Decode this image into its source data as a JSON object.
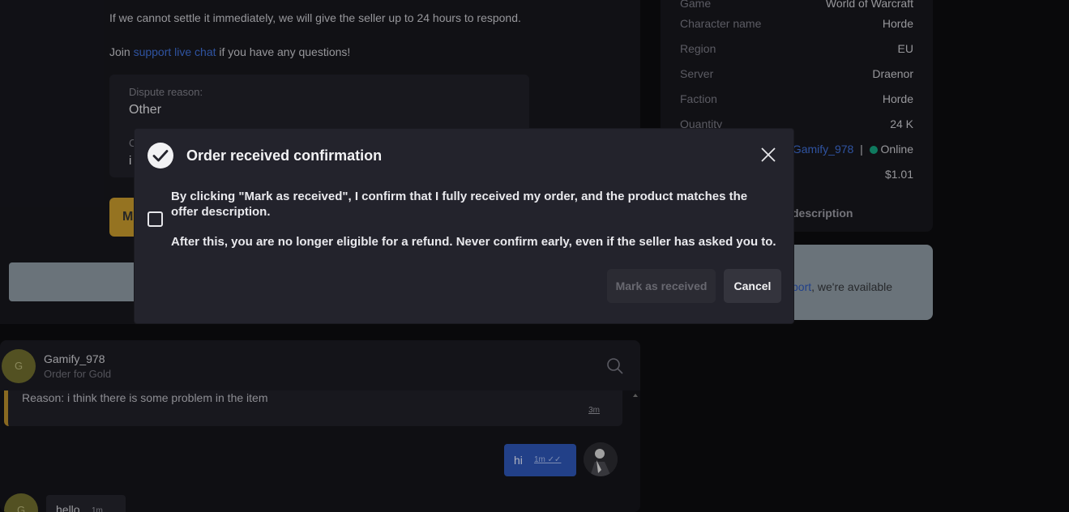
{
  "background": {
    "line_settle": "If we cannot settle it immediately, we will give the seller up to 24 hours to respond.",
    "join_prefix": "Join ",
    "join_link": "support live chat",
    "join_suffix": " if you have any questions!",
    "dispute_reason_label": "Dispute reason:",
    "dispute_reason_value": "Other",
    "comment_label_partial": "C",
    "comment_value_partial": "i",
    "yellow_button_partial": "M"
  },
  "order_details": {
    "rows": [
      {
        "label": "Game",
        "value": "World of Warcraft"
      },
      {
        "label": "Character name",
        "value": "Horde"
      },
      {
        "label": "Region",
        "value": "EU"
      },
      {
        "label": "Server",
        "value": "Draenor"
      },
      {
        "label": "Faction",
        "value": "Horde"
      },
      {
        "label": "Quantity",
        "value": "24 K"
      }
    ],
    "seller_name": "Gamify_978",
    "seller_separator": "|",
    "seller_status": "Online",
    "price": "$1.01",
    "description_partial": "description"
  },
  "support_card": {
    "text_link_partial": "port",
    "text_suffix": ", we're available"
  },
  "chat": {
    "avatar_initial": "G",
    "name": "Gamify_978",
    "subtitle": "Order for Gold",
    "system_message": "Reason: i think there is some problem in the item",
    "system_time": "3m",
    "outgoing_message": "hi",
    "outgoing_time": "1m ✓✓",
    "incoming_avatar_initial": "G",
    "incoming_message": "hello",
    "incoming_time": "1m"
  },
  "modal": {
    "title": "Order received confirmation",
    "paragraph_1": "By clicking \"Mark as received\", I confirm that I fully received my order, and the product matches the offer description.",
    "paragraph_2": "After this, you are no longer eligible for a refund. Never confirm early, even if the seller has asked you to.",
    "mark_button": "Mark as received",
    "cancel_button": "Cancel",
    "checkbox_checked": false
  },
  "colors": {
    "accent_link": "#3f6fd6",
    "online": "#14a37f",
    "warning_yellow": "#c79a2d",
    "modal_bg": "#23232c"
  }
}
